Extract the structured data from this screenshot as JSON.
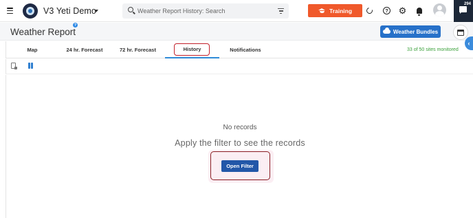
{
  "topbar": {
    "app_name": "V3 Yeti Demo",
    "search_placeholder": "Weather Report History: Search",
    "training_label": "Training",
    "chat_badge": "294"
  },
  "header": {
    "page_title": "Weather Report",
    "info_label": "?",
    "bundles_label": "Weather Bundles"
  },
  "tabs": [
    {
      "label": "Map",
      "active": false
    },
    {
      "label": "24 hr. Forecast",
      "active": false
    },
    {
      "label": "72 hr. Forecast",
      "active": false
    },
    {
      "label": "History",
      "active": true
    },
    {
      "label": "Notifications",
      "active": false
    }
  ],
  "sites_status": "33 of 50 sites monitored",
  "content": {
    "no_records": "No records",
    "apply_filter": "Apply the filter to see the records",
    "open_filter_label": "Open Filter"
  },
  "colors": {
    "training": "#f0592b",
    "bundles": "#2771c9",
    "open_filter": "#2257a8",
    "highlight": "#c2202b",
    "sites_status": "#3aa03a"
  }
}
